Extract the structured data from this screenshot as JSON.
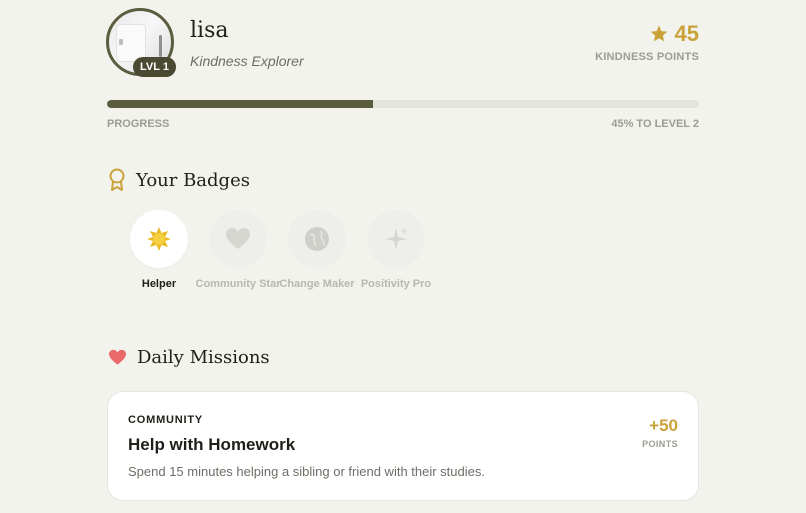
{
  "profile": {
    "username": "lisa",
    "title": "Kindness Explorer",
    "level_badge": "LVL 1",
    "points": "45",
    "points_label": "KINDNESS POINTS"
  },
  "progress": {
    "label": "PROGRESS",
    "next_level_text": "45% TO LEVEL 2",
    "fraction": 0.45
  },
  "badges": {
    "title": "Your Badges",
    "items": [
      {
        "name": "Helper",
        "icon": "star-burst-icon",
        "earned": true
      },
      {
        "name": "Community Star",
        "icon": "heart-icon",
        "earned": false
      },
      {
        "name": "Change Maker",
        "icon": "globe-icon",
        "earned": false
      },
      {
        "name": "Positivity Pro",
        "icon": "sparkles-icon",
        "earned": false
      }
    ]
  },
  "missions": {
    "title": "Daily Missions",
    "items": [
      {
        "category": "COMMUNITY",
        "title": "Help with Homework",
        "description": "Spend 15 minutes helping a sibling or friend with their studies.",
        "points": "+50",
        "points_label": "POINTS"
      }
    ]
  },
  "colors": {
    "background": "#f3f3ee",
    "accent_dark": "#5c5c3e",
    "gold": "#c9a23a",
    "heart": "#e96a6a"
  }
}
